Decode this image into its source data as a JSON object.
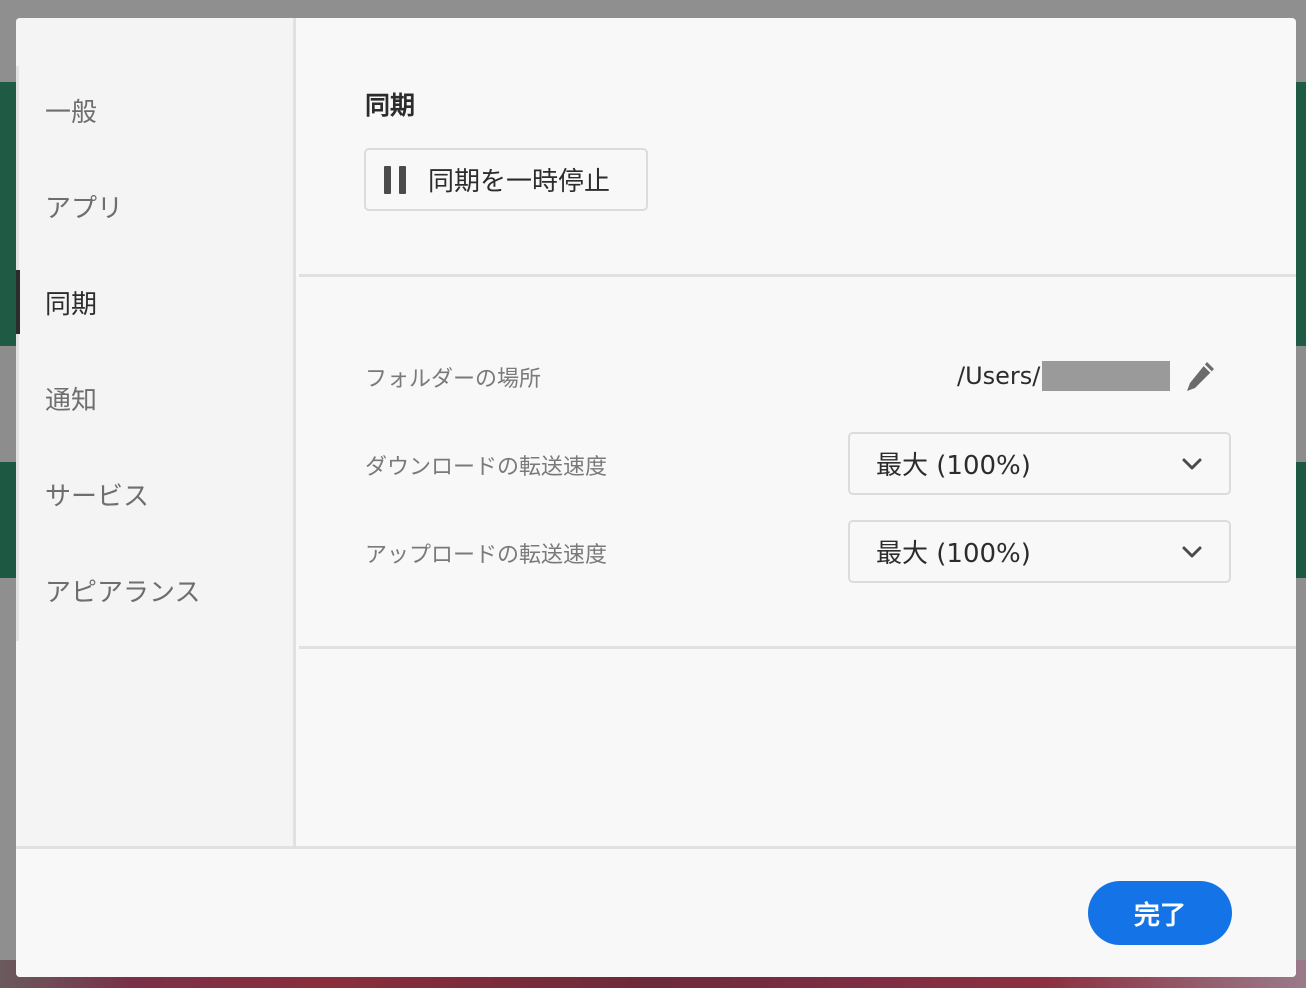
{
  "sidebar": {
    "items": [
      {
        "label": "一般",
        "active": false
      },
      {
        "label": "アプリ",
        "active": false
      },
      {
        "label": "同期",
        "active": true
      },
      {
        "label": "通知",
        "active": false
      },
      {
        "label": "サービス",
        "active": false
      },
      {
        "label": "アピアランス",
        "active": false
      }
    ]
  },
  "sync": {
    "title": "同期",
    "pause_button": {
      "label": "同期を一時停止",
      "icon": "pause-icon"
    }
  },
  "settings": {
    "folder": {
      "label": "フォルダーの場所",
      "path": "/Users/",
      "edit_icon": "pencil-icon"
    },
    "download": {
      "label": "ダウンロードの転送速度",
      "value": "最大 (100%)",
      "icon": "chevron-down-icon"
    },
    "upload": {
      "label": "アップロードの転送速度",
      "value": "最大 (100%)",
      "icon": "chevron-down-icon"
    }
  },
  "footer": {
    "done_label": "完了"
  },
  "colors": {
    "accent": "#1473e6",
    "dialog_bg": "#f8f8f8",
    "sidebar_bg": "#f4f4f4",
    "text_primary": "#2c2c2c",
    "text_secondary": "#7a7a7a"
  }
}
